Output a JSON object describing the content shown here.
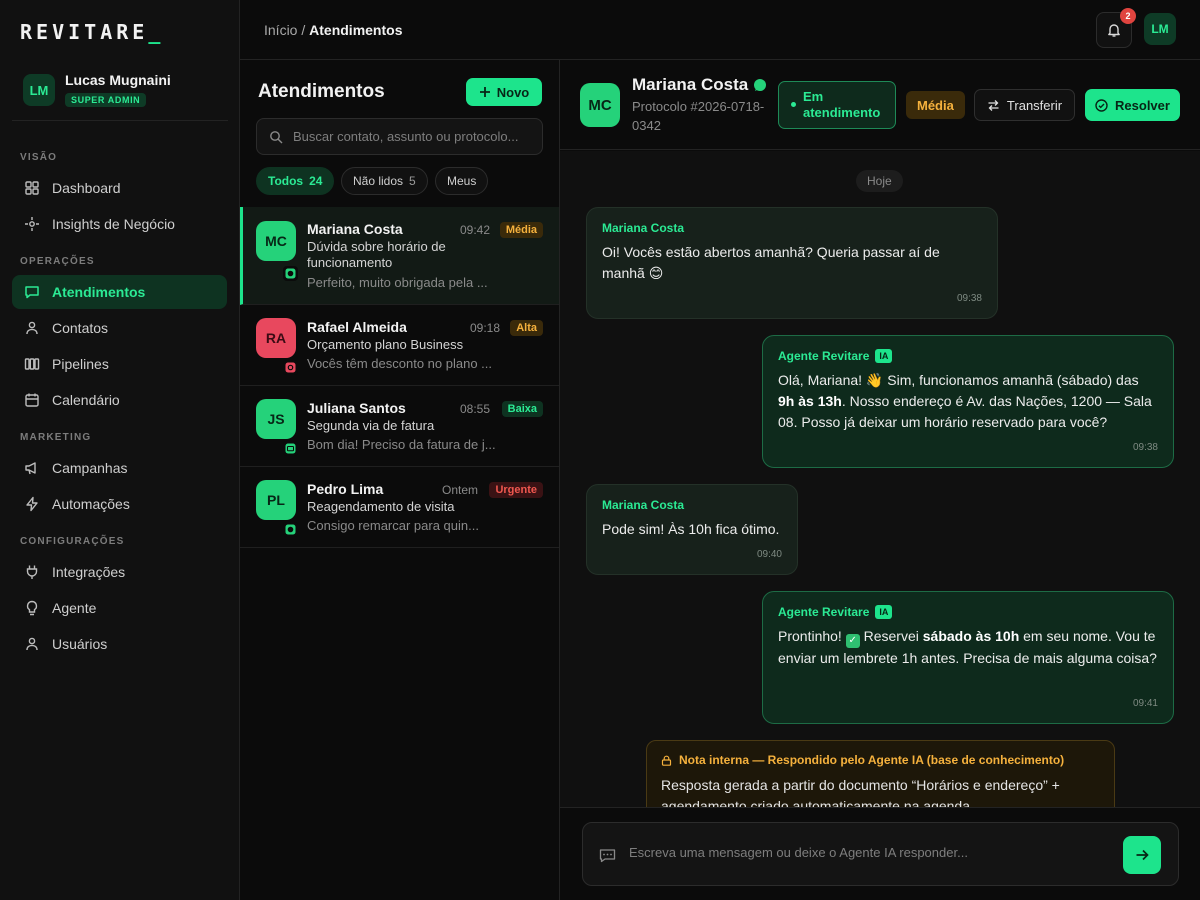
{
  "app": {
    "logo": "REVITARE",
    "logo_cursor": "_"
  },
  "colors": {
    "accent": "#1de48c",
    "background": "#0b0b0b",
    "priority_media": "#f5b13d",
    "priority_alta": "#f5b13d",
    "priority_baixa": "#2bea94",
    "priority_urgente": "#f0574f"
  },
  "user": {
    "initials": "LM",
    "name": "Lucas Mugnaini",
    "role": "SUPER ADMIN"
  },
  "sidebar": {
    "sections": {
      "visao": "VISÃO",
      "operacoes": "OPERAÇÕES",
      "marketing": "MARKETING",
      "configuracoes": "CONFIGURAÇÕES"
    },
    "items": {
      "dashboard": {
        "label": "Dashboard",
        "icon": "grid-icon"
      },
      "insights": {
        "label": "Insights de Negócio",
        "icon": "target-icon"
      },
      "atendimentos": {
        "label": "Atendimentos",
        "icon": "chat-icon"
      },
      "contatos": {
        "label": "Contatos",
        "icon": "user-icon"
      },
      "pipelines": {
        "label": "Pipelines",
        "icon": "columns-icon"
      },
      "calendario": {
        "label": "Calendário",
        "icon": "calendar-icon"
      },
      "campanhas": {
        "label": "Campanhas",
        "icon": "megaphone-icon"
      },
      "automacoes": {
        "label": "Automações",
        "icon": "bolt-icon"
      },
      "integracoes": {
        "label": "Integrações",
        "icon": "plug-icon"
      },
      "agente": {
        "label": "Agente",
        "icon": "bulb-icon"
      },
      "usuarios": {
        "label": "Usuários",
        "icon": "user-icon"
      }
    }
  },
  "topbar": {
    "breadcrumb_root": "Início",
    "breadcrumb_sep": " / ",
    "breadcrumb_current": "Atendimentos",
    "notifications": "2",
    "avatar": "LM"
  },
  "list": {
    "title": "Atendimentos",
    "new_label": "Novo",
    "search_placeholder": "Buscar contato, assunto ou protocolo...",
    "filters": [
      {
        "label": "Todos",
        "count": "24"
      },
      {
        "label": "Não lidos",
        "count": "5"
      },
      {
        "label": "Meus",
        "count": ""
      }
    ],
    "conversations": [
      {
        "initials": "MC",
        "name": "Mariana Costa",
        "time": "09:42",
        "priority": "Média",
        "subject": "Dúvida sobre horário de funcionamento",
        "preview": "Perfeito, muito obrigada pela ...",
        "channel": "whatsapp-icon"
      },
      {
        "initials": "RA",
        "name": "Rafael Almeida",
        "time": "09:18",
        "priority": "Alta",
        "subject": "Orçamento plano Business",
        "preview": "Vocês têm desconto no plano ...",
        "channel": "instagram-icon"
      },
      {
        "initials": "JS",
        "name": "Juliana Santos",
        "time": "08:55",
        "priority": "Baixa",
        "subject": "Segunda via de fatura",
        "preview": "Bom dia! Preciso da fatura de j...",
        "channel": "email-icon"
      },
      {
        "initials": "PL",
        "name": "Pedro Lima",
        "time": "Ontem",
        "priority": "Urgente",
        "subject": "Reagendamento de visita",
        "preview": "Consigo remarcar para quin...",
        "channel": "whatsapp-icon"
      }
    ]
  },
  "chat": {
    "initials": "MC",
    "name": "Mariana Costa",
    "protocol": "Protocolo #2026-0718-0342",
    "status": "Em atendimento",
    "priority": "Média",
    "transfer_label": "Transferir",
    "resolve_label": "Resolver",
    "day": "Hoje",
    "messages": [
      {
        "from": "Mariana Costa",
        "text": "Oi! Vocês estão abertos amanhã? Queria passar aí de manhã 😊",
        "time": "09:38"
      },
      {
        "from": "Agente Revitare",
        "tag": "IA",
        "text_a": "Olá, Mariana! 👋 Sim, funcionamos amanhã (sábado) das ",
        "bold_a": "9h às 13h",
        "text_b": ". Nosso endereço é Av. das Nações, 1200 — Sala 08. Posso já deixar um horário reservado para você?",
        "time": "09:38"
      },
      {
        "from": "Mariana Costa",
        "text": "Pode sim! Às 10h fica ótimo.",
        "time": "09:40"
      },
      {
        "from": "Agente Revitare",
        "tag": "IA",
        "text_a": "Prontinho! ",
        "text_b": " Reservei ",
        "bold_a": "sábado às 10h",
        "text_c": " em seu nome. Vou te enviar um lembrete 1h antes. Precisa de mais alguma coisa?",
        "time": "09:41"
      }
    ],
    "note": {
      "title": "Nota interna — Respondido pelo Agente IA (base de conhecimento)",
      "text": "Resposta gerada a partir do documento “Horários e endereço” + agendamento criado automaticamente na agenda."
    },
    "composer_placeholder": "Escreva uma mensagem ou deixe o Agente IA responder..."
  }
}
